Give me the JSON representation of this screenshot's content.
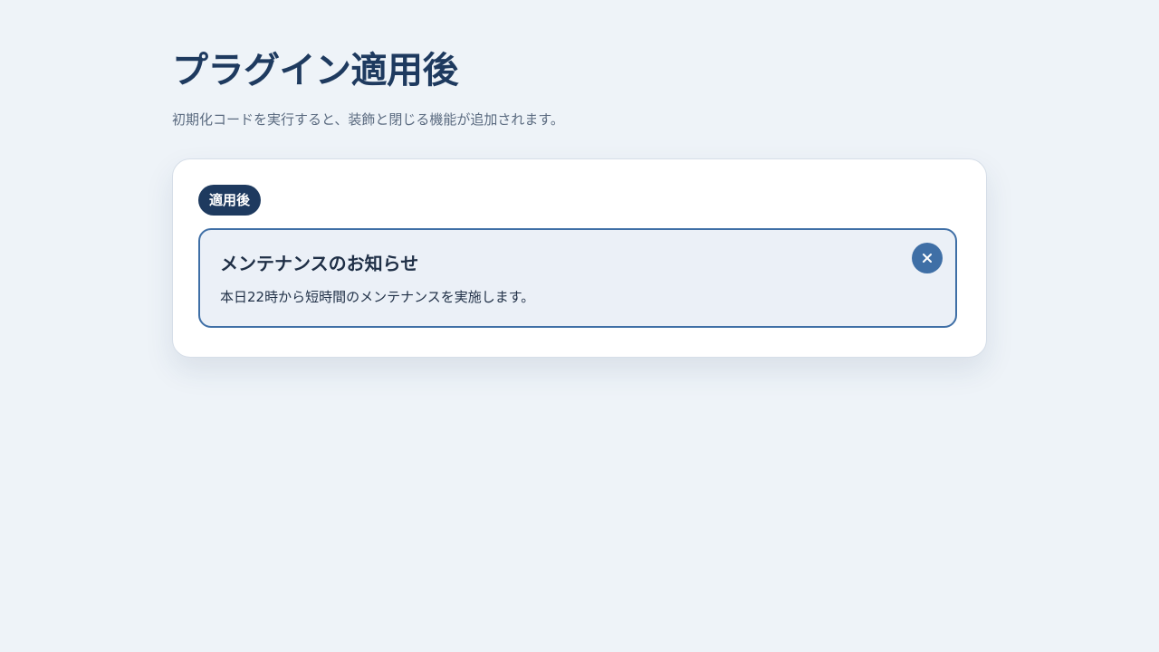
{
  "page": {
    "title": "プラグイン適用後",
    "subtitle": "初期化コードを実行すると、装飾と閉じる機能が追加されます。"
  },
  "card": {
    "badge": "適用後",
    "notice": {
      "title": "メンテナンスのお知らせ",
      "body": "本日22時から短時間のメンテナンスを実施します。",
      "close_icon": "close-icon"
    }
  },
  "colors": {
    "background": "#eef3f8",
    "title": "#1e3a5f",
    "badge": "#1e3a5f",
    "notice_border": "#3f6fa6",
    "notice_background": "#ebf0f7",
    "close_button": "#3f6fa6"
  }
}
